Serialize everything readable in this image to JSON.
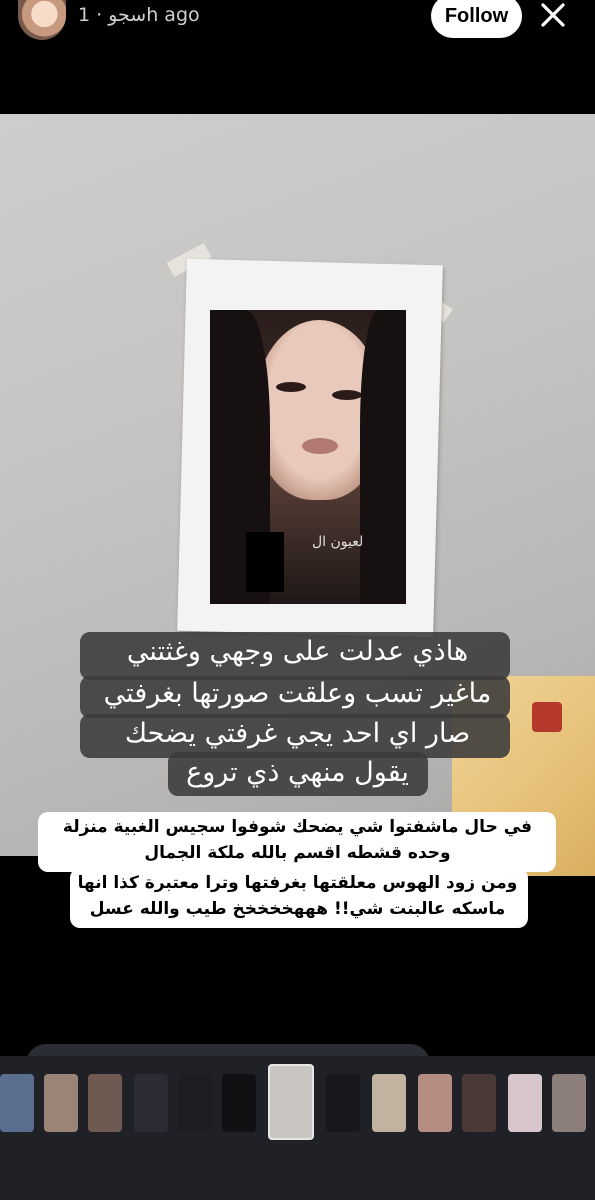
{
  "header": {
    "username": "سجو",
    "time_ago": "1h ago",
    "meta_line": "سجو · 1h ago",
    "follow_label": "Follow",
    "close_icon": "close-icon"
  },
  "story": {
    "watermark": "لعيون ال",
    "caption_lines": [
      "هاذي عدلت على وجهي وغثتني",
      "ماغير تسب وعلقت صورتها بغرفتي",
      "صار اي احد يجي غرفتي يضحك",
      "يقول منهي ذي تروع"
    ],
    "comment_lines": [
      "في حال ماشفتوا شي يضحك شوفوا سجيس الغبية منزلة",
      "وحده قشطه اقسم بالله ملكة الجمال",
      "ومن زود الهوس معلقتها بغرفتها وترا معتبرة كذا انها",
      "ماسكه عالبنت شي!! هههخخخخخ طيب والله عسل"
    ]
  },
  "thumbnails": [
    {
      "name": "thumb-1",
      "color": "#5a6f8f"
    },
    {
      "name": "thumb-2",
      "color": "#9a8478"
    },
    {
      "name": "thumb-3",
      "color": "#6f5a52"
    },
    {
      "name": "thumb-4",
      "color": "#2b2b34"
    },
    {
      "name": "thumb-5",
      "color": "#1d1d22"
    },
    {
      "name": "thumb-6",
      "color": "#111114"
    },
    {
      "name": "thumb-7",
      "color": "#c9c6c2",
      "active": true
    },
    {
      "name": "thumb-8",
      "color": "#18181c"
    },
    {
      "name": "thumb-9",
      "color": "#c1b39f"
    },
    {
      "name": "thumb-10",
      "color": "#b48c82"
    },
    {
      "name": "thumb-11",
      "color": "#4a3a36"
    },
    {
      "name": "thumb-12",
      "color": "#d7c6cb"
    },
    {
      "name": "thumb-13",
      "color": "#8c7f7a"
    }
  ]
}
